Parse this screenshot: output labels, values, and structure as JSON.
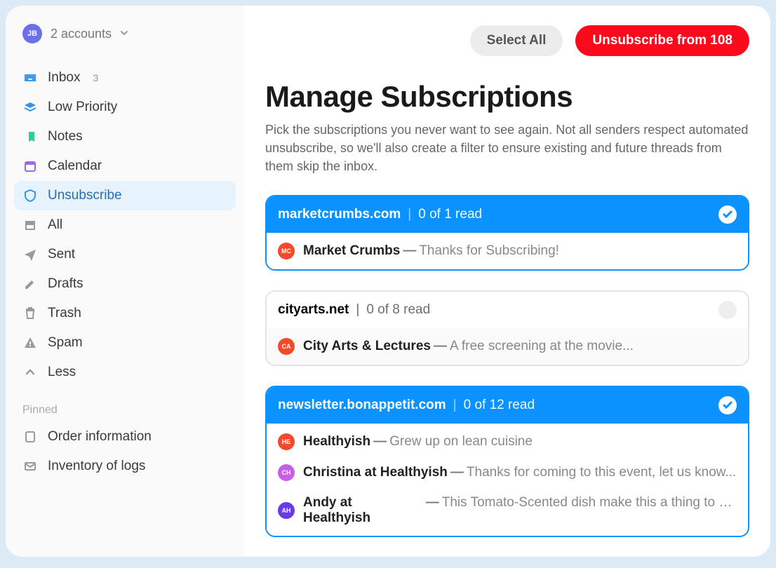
{
  "header": {
    "avatar_initials": "JB",
    "accounts_label": "2 accounts"
  },
  "sidebar": {
    "items": [
      {
        "id": "inbox",
        "label": "Inbox",
        "count": "3",
        "icon": "tray",
        "color": "#3795e8"
      },
      {
        "id": "low-priority",
        "label": "Low Priority",
        "icon": "stack",
        "color": "#3795e8"
      },
      {
        "id": "notes",
        "label": "Notes",
        "icon": "note",
        "color": "#2ecf8f"
      },
      {
        "id": "calendar",
        "label": "Calendar",
        "icon": "calendar",
        "color": "#9a6ae8"
      },
      {
        "id": "unsubscribe",
        "label": "Unsubscribe",
        "icon": "shield",
        "color": "#3795e8",
        "active": true
      },
      {
        "id": "all",
        "label": "All",
        "icon": "archive",
        "color": "#9a9a9a"
      },
      {
        "id": "sent",
        "label": "Sent",
        "icon": "plane",
        "color": "#9a9a9a"
      },
      {
        "id": "drafts",
        "label": "Drafts",
        "icon": "pencil",
        "color": "#9a9a9a"
      },
      {
        "id": "trash",
        "label": "Trash",
        "icon": "trash",
        "color": "#9a9a9a"
      },
      {
        "id": "spam",
        "label": "Spam",
        "icon": "warn",
        "color": "#9a9a9a"
      },
      {
        "id": "less",
        "label": "Less",
        "icon": "chevup",
        "color": "#9a9a9a"
      }
    ],
    "pinned_label": "Pinned",
    "pinned": [
      {
        "id": "order-info",
        "label": "Order information",
        "icon": "doc",
        "color": "#9a9a9a"
      },
      {
        "id": "inventory",
        "label": "Inventory of logs",
        "icon": "mail",
        "color": "#9a9a9a"
      }
    ]
  },
  "actions": {
    "select_all": "Select All",
    "unsubscribe": "Unsubscribe  from 108"
  },
  "page": {
    "title": "Manage Subscriptions",
    "description": "Pick the subscriptions you never want to see again. Not all senders respect automated unsubscribe, so we'll also create a filter to ensure existing and future threads from them skip the inbox."
  },
  "subscriptions": [
    {
      "domain": "marketcrumbs.com",
      "read_status": "0 of 1 read",
      "selected": true,
      "messages": [
        {
          "avatar": "MC",
          "avatar_color": "#f44a2a",
          "sender": "Market Crumbs",
          "subject": "Thanks for Subscribing!"
        }
      ]
    },
    {
      "domain": "cityarts.net",
      "read_status": "0 of 8 read",
      "selected": false,
      "messages": [
        {
          "avatar": "CA",
          "avatar_color": "#f44a2a",
          "sender": "City Arts & Lectures",
          "subject": "A free screening at the movie..."
        }
      ]
    },
    {
      "domain": "newsletter.bonappetit.com",
      "read_status": "0 of 12 read",
      "selected": true,
      "messages": [
        {
          "avatar": "HE",
          "avatar_color": "#f44a2a",
          "sender": "Healthyish",
          "subject": "Grew up on lean cuisine"
        },
        {
          "avatar": "CH",
          "avatar_color": "#c95de8",
          "sender": "Christina at Healthyish",
          "subject": "Thanks for coming to this event, let us know..."
        },
        {
          "avatar": "AH",
          "avatar_color": "#6a3ae8",
          "sender": "Andy at Healthyish",
          "subject": "This Tomato-Scented dish make this a thing to a..."
        }
      ]
    }
  ]
}
